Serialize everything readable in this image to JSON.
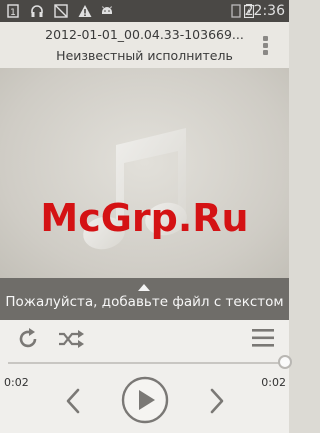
{
  "status_bar": {
    "time": "22:36",
    "icons": [
      "sim-card-icon",
      "headphones-icon",
      "no-signal-icon",
      "warning-icon",
      "android-icon",
      "no-sim-icon",
      "battery-charging-icon"
    ]
  },
  "header": {
    "title": "2012-01-01_00.04.33-103669...",
    "artist": "Неизвестный исполнитель"
  },
  "watermark": "McGrp.Ru",
  "lyrics": {
    "prompt": "Пожалуйста, добавьте файл с текстом"
  },
  "player": {
    "elapsed": "0:02",
    "duration": "0:02",
    "progress_fraction": 1.0
  },
  "colors": {
    "status_bar": "#4a4845",
    "lyrics_bar": "#6f6d69",
    "watermark": "#d41214",
    "icon_gray": "#7a7875"
  }
}
